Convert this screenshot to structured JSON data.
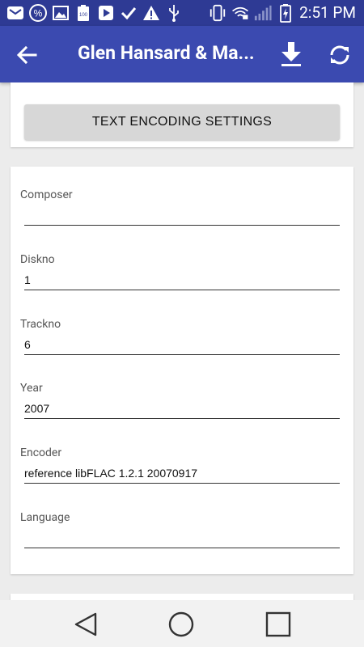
{
  "status_bar": {
    "time": "2:51 PM",
    "icons": [
      "mail-icon",
      "percent-icon",
      "image-icon",
      "battery-100-icon",
      "play-store-icon",
      "check-icon",
      "warning-icon",
      "usb-icon",
      "phone-vibrate-icon",
      "wifi-lock-icon",
      "signal-icon",
      "battery-charging-icon"
    ]
  },
  "app_bar": {
    "title": "Glen Hansard & Ma..."
  },
  "text_encoding": {
    "button_label": "TEXT ENCODING SETTINGS"
  },
  "fields": [
    {
      "label": "Composer",
      "value": ""
    },
    {
      "label": "Diskno",
      "value": "1"
    },
    {
      "label": "Trackno",
      "value": "6"
    },
    {
      "label": "Year",
      "value": "2007"
    },
    {
      "label": "Encoder",
      "value": "reference libFLAC 1.2.1 20070917"
    },
    {
      "label": "Language",
      "value": ""
    }
  ]
}
